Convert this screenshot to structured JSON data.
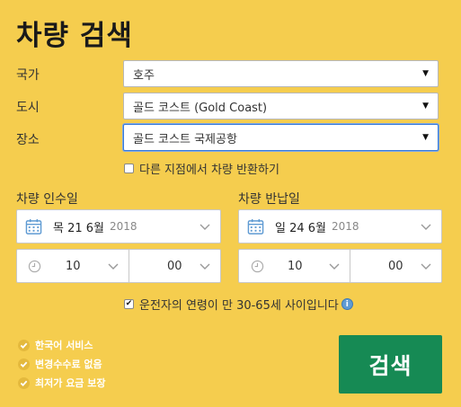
{
  "page": {
    "title": "차량 검색"
  },
  "form": {
    "country": {
      "label": "국가",
      "value": "호주"
    },
    "city": {
      "label": "도시",
      "value": "골드 코스트 (Gold Coast)"
    },
    "location": {
      "label": "장소",
      "value": "골드 코스트 국제공항"
    },
    "return_different": {
      "label": "다른 지점에서 차량 반환하기",
      "checked": false
    }
  },
  "pickup": {
    "label": "차량 인수일",
    "date": "목 21 6월",
    "year": "2018",
    "hour": "10",
    "minute": "00"
  },
  "dropoff": {
    "label": "차량 반납일",
    "date": "일 24 6월",
    "year": "2018",
    "hour": "10",
    "minute": "00"
  },
  "driver_age": {
    "label": "운전자의 연령이 만 30-65세 사이입니다",
    "checked": true,
    "info_icon": "i"
  },
  "features": [
    {
      "label": "한국어 서비스"
    },
    {
      "label": "변경수수료 없음"
    },
    {
      "label": "최저가 요금 보장"
    }
  ],
  "search_button": {
    "label": "검색",
    "color": "#168a54"
  },
  "colors": {
    "background": "#f5cd4e",
    "focus": "#3a7bd5",
    "icon_blue": "#5f9bd3"
  }
}
